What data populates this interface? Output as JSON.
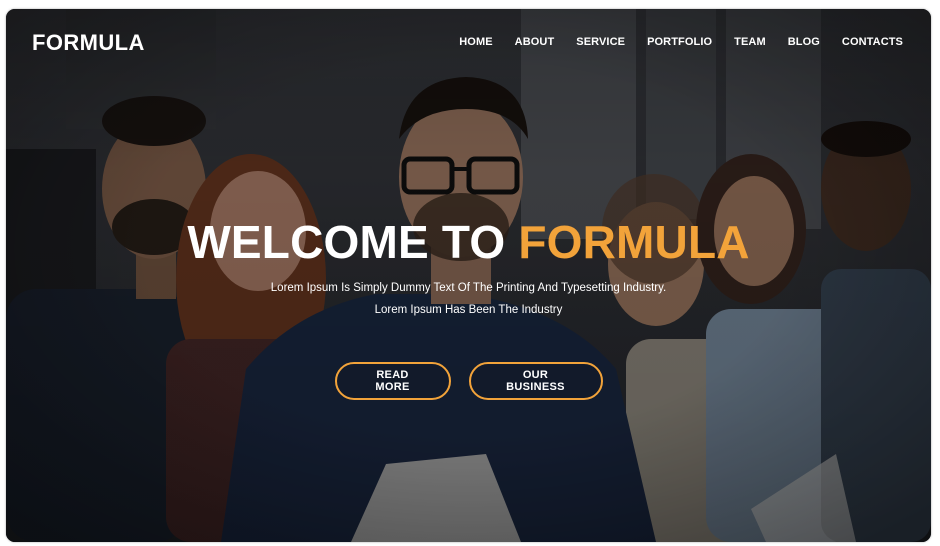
{
  "brand": {
    "logo": "FORMULA",
    "accent_color": "#f2a33a"
  },
  "nav": {
    "items": [
      "HOME",
      "ABOUT",
      "SERVICE",
      "PORTFOLIO",
      "TEAM",
      "BLOG",
      "CONTACTS"
    ]
  },
  "hero": {
    "title_part1": "WELCOME TO",
    "title_part2": "FORMULA",
    "subtitle_line1": "Lorem Ipsum Is Simply Dummy Text Of The Printing And Typesetting Industry.",
    "subtitle_line2": "Lorem Ipsum Has Been The Industry",
    "background": "team-photo"
  },
  "buttons": {
    "read_more": "READ MORE",
    "our_business": "OUR BUSINESS"
  }
}
